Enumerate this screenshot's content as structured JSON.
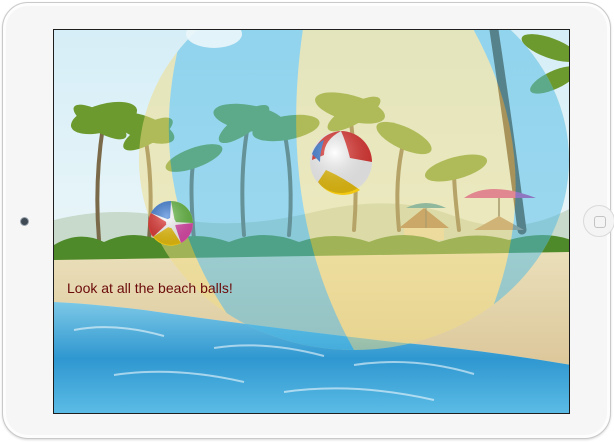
{
  "screen": {
    "message": "Look at all the beach balls!"
  },
  "scene": {
    "sky_color": "#c8eaf5",
    "sand_color": "#efdfae",
    "water_color": "#39a9d8",
    "palm_green": "#6f9a2d",
    "umbrella_color": "#d0309c",
    "ball_colors": [
      "#e53935",
      "#ffffff",
      "#f2c811",
      "#3f7fd8",
      "#6cc04a",
      "#e54fb0"
    ]
  },
  "device": {
    "home_button_icon": "home-button-icon",
    "camera_icon": "front-camera-icon"
  }
}
